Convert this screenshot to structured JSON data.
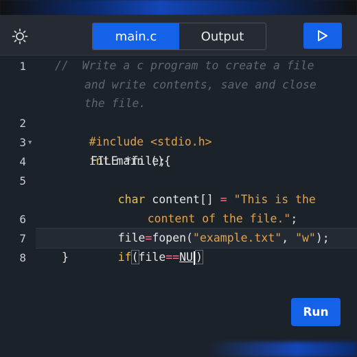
{
  "header": {
    "theme_icon": "sun-icon",
    "tabs": [
      {
        "label": "main.c",
        "active": true
      },
      {
        "label": "Output",
        "active": false
      }
    ],
    "play_icon": "play-icon"
  },
  "editor": {
    "line_numbers": [
      "1",
      "2",
      "3",
      "4",
      "5",
      "6",
      "7",
      "8"
    ],
    "comment": [
      "//  Write a c program to create a file",
      "and write contents, save and close",
      "the file."
    ],
    "include": {
      "directive": "#include",
      "header": "<stdio.h>"
    },
    "main_decl": {
      "type": "int",
      "rest": " main (){"
    },
    "file_decl": "FILE *file;",
    "content_decl": {
      "type": "char",
      "name": " content[] ",
      "eq": "=",
      "str1": " \"This is the",
      "str2": "content of the file.\"",
      "semi": ";"
    },
    "fopen_line": {
      "var": "file",
      "eq": "=",
      "fn": "fopen(",
      "arg1": "\"example.txt\"",
      "comma": ", ",
      "arg2": "\"w\"",
      "end": ");"
    },
    "if_line": {
      "kw": "if",
      "open": "(",
      "var": "file",
      "op": "==",
      "val": "NU",
      "close": ")"
    },
    "close_brace": "}"
  },
  "run_button": {
    "label": "Run"
  },
  "colors": {
    "accent": "#1362e8",
    "background": "#1c222a",
    "string": "#e4a24a",
    "keyword": "#f0c040"
  }
}
